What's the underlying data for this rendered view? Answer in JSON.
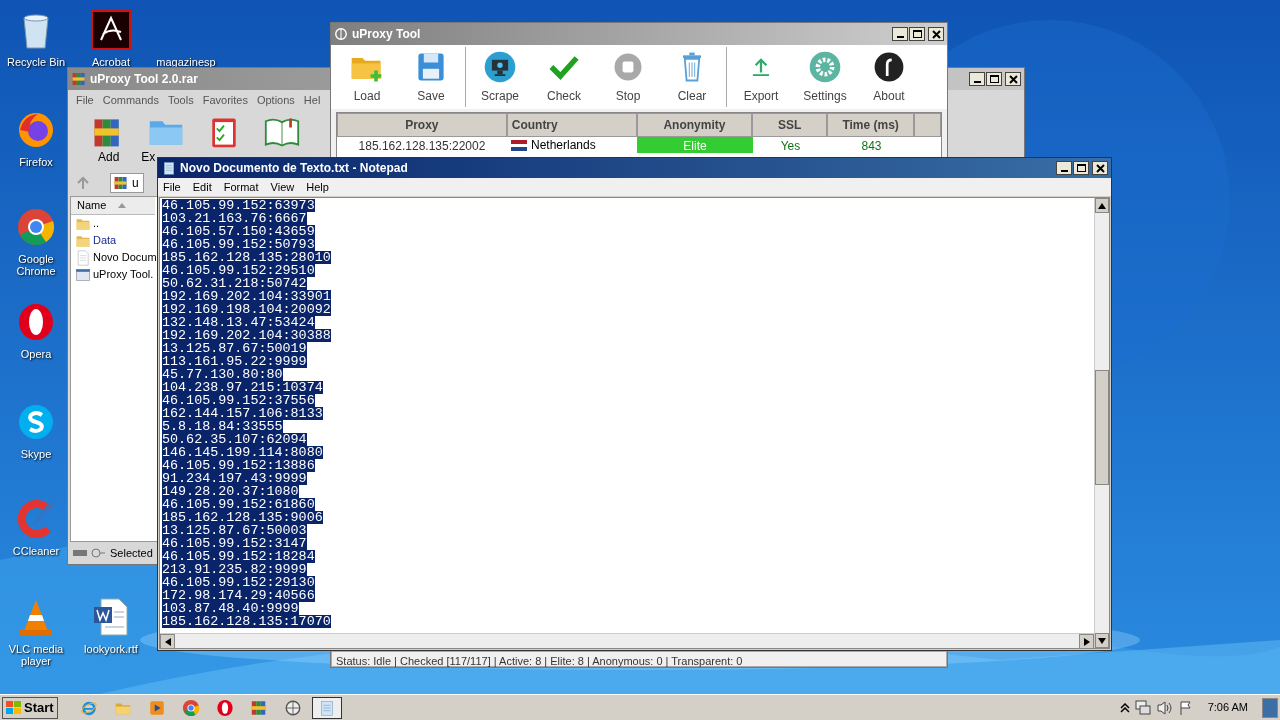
{
  "desktop_icons": [
    {
      "label": "Recycle Bin",
      "kind": "recycle"
    },
    {
      "label": "Acrobat",
      "kind": "acrobat"
    },
    {
      "label": "magazinesp",
      "kind": "blank"
    },
    {
      "label": "Firefox",
      "kind": "firefox"
    },
    {
      "label": "Google Chrome",
      "kind": "chrome"
    },
    {
      "label": "Opera",
      "kind": "opera"
    },
    {
      "label": "Skype",
      "kind": "skype"
    },
    {
      "label": "CCleaner",
      "kind": "ccleaner"
    },
    {
      "label": "VLC media player",
      "kind": "vlc"
    },
    {
      "label": "lookyork.rtf",
      "kind": "word"
    }
  ],
  "winrar": {
    "title": "uProxy Tool 2.0.rar",
    "menu": [
      "File",
      "Commands",
      "Tools",
      "Favorites",
      "Options",
      "Hel"
    ],
    "toolbar": [
      {
        "label": "Add",
        "kind": "add"
      },
      {
        "label": "Ex",
        "kind": "extract"
      },
      {
        "kind": "test"
      },
      {
        "kind": "book"
      }
    ],
    "address": "u",
    "column": "Name",
    "files": [
      {
        "name": "..",
        "kind": "folder"
      },
      {
        "name": "Data",
        "kind": "folder"
      },
      {
        "name": "Novo Docum",
        "kind": "text"
      },
      {
        "name": "uProxy Tool.",
        "kind": "app"
      }
    ],
    "status": "Selected"
  },
  "uproxy": {
    "title": "uProxy Tool",
    "toolbar": [
      {
        "label": "Load",
        "kind": "load"
      },
      {
        "label": "Save",
        "kind": "save"
      },
      {
        "label": "Scrape",
        "kind": "scrape"
      },
      {
        "label": "Check",
        "kind": "check"
      },
      {
        "label": "Stop",
        "kind": "stop"
      },
      {
        "label": "Clear",
        "kind": "clear"
      },
      {
        "label": "Export",
        "kind": "export"
      },
      {
        "label": "Settings",
        "kind": "settings"
      },
      {
        "label": "About",
        "kind": "about"
      }
    ],
    "columns": [
      "Proxy",
      "Country",
      "Anonymity",
      "SSL",
      "Time (ms)"
    ],
    "rows": [
      {
        "proxy": "185.162.128.135:22002",
        "country": "Netherlands",
        "anonymity": "Elite",
        "ssl": "Yes",
        "time": "843"
      }
    ],
    "status": "Status: Idle | Checked [117/117] | Active: 8 | Elite: 8 | Anonymous: 0 | Transparent: 0"
  },
  "notepad": {
    "title": "Novo Documento de Texto.txt - Notepad",
    "menu": [
      "File",
      "Edit",
      "Format",
      "View",
      "Help"
    ],
    "lines": [
      "46.105.99.152:63973",
      "103.21.163.76:6667",
      "46.105.57.150:43659",
      "46.105.99.152:50793",
      "185.162.128.135:28010",
      "46.105.99.152:29510",
      "50.62.31.218:50742",
      "192.169.202.104:33901",
      "192.169.198.104:20092",
      "132.148.13.47:53424",
      "192.169.202.104:30388",
      "13.125.87.67:50019",
      "113.161.95.22:9999",
      "45.77.130.80:80",
      "104.238.97.215:10374",
      "46.105.99.152:37556",
      "162.144.157.106:8133",
      "5.8.18.84:33555",
      "50.62.35.107:62094",
      "146.145.199.114:8080",
      "46.105.99.152:13886",
      "91.234.197.43:9999",
      "149.28.20.37:1080",
      "46.105.99.152:61860",
      "185.162.128.135:9006",
      "13.125.87.67:50003",
      "46.105.99.152:3147",
      "46.105.99.152:18284",
      "213.91.235.82:9999",
      "46.105.99.152:29130",
      "172.98.174.29:40566",
      "103.87.48.40:9999",
      "185.162.128.135:17070"
    ]
  },
  "taskbar": {
    "start": "Start",
    "clock": "7:06 AM",
    "buttons": [
      {
        "kind": "ie",
        "selected": false
      },
      {
        "kind": "explorer",
        "selected": false
      },
      {
        "kind": "media",
        "selected": false
      },
      {
        "kind": "chrome",
        "selected": false
      },
      {
        "kind": "opera",
        "selected": false
      },
      {
        "kind": "winrar",
        "selected": false
      },
      {
        "kind": "uproxy",
        "selected": false
      },
      {
        "kind": "notepad",
        "selected": true
      }
    ]
  }
}
